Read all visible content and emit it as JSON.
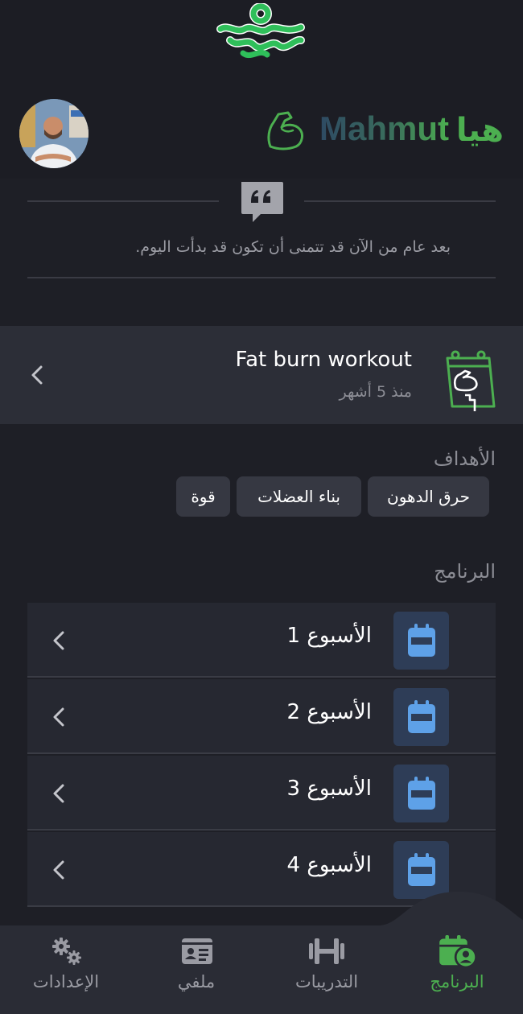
{
  "header": {
    "greeting": "هيا",
    "user_name": "Mahmut"
  },
  "quote": {
    "text": "بعد عام من الآن قد تتمنى أن تكون قد بدأت اليوم."
  },
  "program_card": {
    "title": "Fat burn workout",
    "subtitle": "منذ 5 أشهر"
  },
  "goals": {
    "title": "الأهداف",
    "chips": [
      "حرق الدهون",
      "بناء العضلات",
      "قوة"
    ]
  },
  "program": {
    "title": "البرنامج",
    "weeks": [
      {
        "label": "الأسبوع 1"
      },
      {
        "label": "الأسبوع 2"
      },
      {
        "label": "الأسبوع 3"
      },
      {
        "label": "الأسبوع 4"
      }
    ]
  },
  "bottom_nav": {
    "items": [
      {
        "label": "البرنامج",
        "icon": "calendar-user-icon",
        "active": true
      },
      {
        "label": "التدريبات",
        "icon": "dumbbell-icon",
        "active": false
      },
      {
        "label": "ملفي",
        "icon": "id-card-icon",
        "active": false
      },
      {
        "label": "الإعدادات",
        "icon": "gears-icon",
        "active": false
      }
    ]
  },
  "colors": {
    "background": "#1e1f26",
    "accent": "#4caf50",
    "card": "#2c2e37",
    "week_icon": "#5ea1e8"
  }
}
